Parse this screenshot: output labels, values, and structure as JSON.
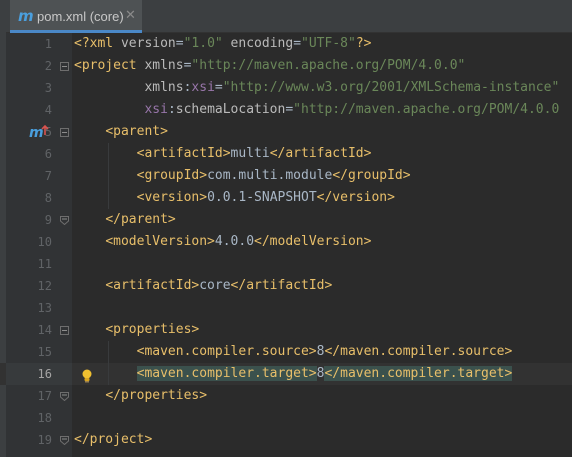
{
  "tab": {
    "icon": "maven-m-icon",
    "label": "pom.xml (core)",
    "close": "✕"
  },
  "editor": {
    "current_line": 16,
    "lines": [
      {
        "n": "1",
        "tokens": [
          [
            "pi",
            "<?xml "
          ],
          [
            "at",
            "version"
          ],
          [
            "txt",
            "="
          ],
          [
            "val",
            "\"1.0\""
          ],
          [
            "at",
            " encoding"
          ],
          [
            "txt",
            "="
          ],
          [
            "val",
            "\"UTF-8\""
          ],
          [
            "pi",
            "?>"
          ]
        ]
      },
      {
        "n": "2",
        "tokens": [
          [
            "tg",
            "<project "
          ],
          [
            "at",
            "xmlns"
          ],
          [
            "txt",
            "="
          ],
          [
            "val",
            "\"http://maven.apache.org/POM/4.0.0\""
          ]
        ]
      },
      {
        "n": "3",
        "tokens": [
          [
            "txt",
            "         "
          ],
          [
            "at",
            "xmlns"
          ],
          [
            "txt",
            ":"
          ],
          [
            "ns",
            "xsi"
          ],
          [
            "txt",
            "="
          ],
          [
            "val",
            "\"http://www.w3.org/2001/XMLSchema-instance\""
          ]
        ]
      },
      {
        "n": "4",
        "tokens": [
          [
            "txt",
            "         "
          ],
          [
            "ns",
            "xsi"
          ],
          [
            "txt",
            ":"
          ],
          [
            "at",
            "schemaLocation"
          ],
          [
            "txt",
            "="
          ],
          [
            "val",
            "\"http://maven.apache.org/POM/4.0.0 "
          ]
        ]
      },
      {
        "n": "5",
        "tokens": [
          [
            "txt",
            "    "
          ],
          [
            "tg",
            "<parent>"
          ]
        ]
      },
      {
        "n": "6",
        "tokens": [
          [
            "txt",
            "        "
          ],
          [
            "tg",
            "<artifactId>"
          ],
          [
            "txt",
            "multi"
          ],
          [
            "tg",
            "</artifactId>"
          ]
        ]
      },
      {
        "n": "7",
        "tokens": [
          [
            "txt",
            "        "
          ],
          [
            "tg",
            "<groupId>"
          ],
          [
            "txt",
            "com.multi.module"
          ],
          [
            "tg",
            "</groupId>"
          ]
        ]
      },
      {
        "n": "8",
        "tokens": [
          [
            "txt",
            "        "
          ],
          [
            "tg",
            "<version>"
          ],
          [
            "txt",
            "0.0.1-SNAPSHOT"
          ],
          [
            "tg",
            "</version>"
          ]
        ]
      },
      {
        "n": "9",
        "tokens": [
          [
            "txt",
            "    "
          ],
          [
            "tg",
            "</parent>"
          ]
        ]
      },
      {
        "n": "10",
        "tokens": [
          [
            "txt",
            "    "
          ],
          [
            "tg",
            "<modelVersion>"
          ],
          [
            "txt",
            "4.0.0"
          ],
          [
            "tg",
            "</modelVersion>"
          ]
        ]
      },
      {
        "n": "11",
        "tokens": []
      },
      {
        "n": "12",
        "tokens": [
          [
            "txt",
            "    "
          ],
          [
            "tg",
            "<artifactId>"
          ],
          [
            "txt",
            "core"
          ],
          [
            "tg",
            "</artifactId>"
          ]
        ]
      },
      {
        "n": "13",
        "tokens": []
      },
      {
        "n": "14",
        "tokens": [
          [
            "txt",
            "    "
          ],
          [
            "tg",
            "<properties>"
          ]
        ]
      },
      {
        "n": "15",
        "tokens": [
          [
            "txt",
            "        "
          ],
          [
            "tg",
            "<maven.compiler.source>"
          ],
          [
            "txt",
            "8"
          ],
          [
            "tg",
            "</maven.compiler.source>"
          ]
        ]
      },
      {
        "n": "16",
        "tokens": [
          [
            "txt",
            "        "
          ],
          [
            "tg hl",
            "<maven.compiler.target>"
          ],
          [
            "txt",
            "8"
          ],
          [
            "tg hl",
            "</maven.compiler.target>"
          ]
        ]
      },
      {
        "n": "17",
        "tokens": [
          [
            "txt",
            "    "
          ],
          [
            "tg",
            "</properties>"
          ]
        ]
      },
      {
        "n": "18",
        "tokens": []
      },
      {
        "n": "19",
        "tokens": [
          [
            "tg",
            "</project>"
          ]
        ]
      }
    ]
  },
  "gutter_markers": {
    "line5": "maven-parent-override-icon",
    "line16": "intention-bulb-icon"
  },
  "colors": {
    "background": "#2b2b2b",
    "tag": "#e8bf6a",
    "attribute": "#bababa",
    "namespace": "#9876aa",
    "value": "#6a8759",
    "text": "#a9b7c6"
  }
}
